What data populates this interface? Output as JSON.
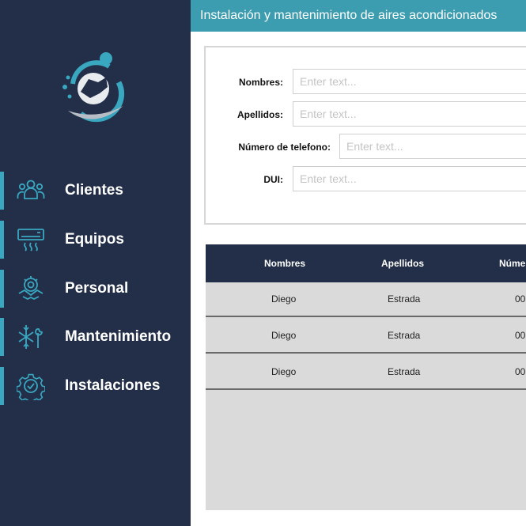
{
  "header": {
    "title": "Instalación y mantenimiento de aires acondicionados"
  },
  "sidebar": {
    "items": [
      {
        "label": "Clientes",
        "icon": "users-icon"
      },
      {
        "label": "Equipos",
        "icon": "air-conditioner-icon"
      },
      {
        "label": "Personal",
        "icon": "handshake-gear-icon"
      },
      {
        "label": "Mantenimiento",
        "icon": "snowflake-wrench-icon"
      },
      {
        "label": "Instalaciones",
        "icon": "gear-check-icon"
      }
    ]
  },
  "form": {
    "nombres": {
      "label": "Nombres:",
      "placeholder": "Enter text..."
    },
    "apellidos": {
      "label": "Apellidos:",
      "placeholder": "Enter text..."
    },
    "telefono": {
      "label": "Número de telefono:",
      "placeholder": "Enter text..."
    },
    "dui": {
      "label": "DUI:",
      "placeholder": "Enter text..."
    }
  },
  "table": {
    "columns": [
      "Nombres",
      "Apellidos",
      "Núme"
    ],
    "rows": [
      [
        "Diego",
        "Estrada",
        "00"
      ],
      [
        "Diego",
        "Estrada",
        "00"
      ],
      [
        "Diego",
        "Estrada",
        "00"
      ]
    ]
  },
  "colors": {
    "sidebar": "#232f48",
    "accent": "#3aa7c0",
    "header": "#3d9db0",
    "table_bg": "#dadada"
  }
}
